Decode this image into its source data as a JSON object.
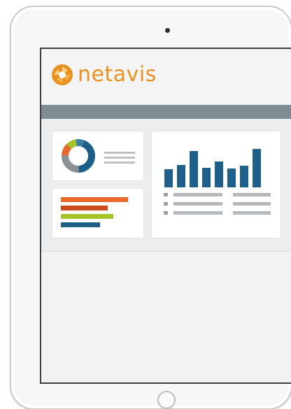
{
  "brand": {
    "name": "netavis",
    "color": "#e8921f"
  },
  "icons": {
    "logo": "netavis-shutter-logo",
    "camera": "front-camera-dot",
    "home": "home-button"
  },
  "colors": {
    "header_bar": "#7e8d94",
    "bar_blue": "#1f5f8b",
    "orange": "#e8682a",
    "dark_orange": "#c94b1b",
    "lime": "#a5c32b",
    "blue": "#1d5e89",
    "gray": "#8a9096"
  },
  "chart_data": [
    {
      "type": "pie",
      "labels": [],
      "values": [
        44,
        26,
        12,
        10,
        8
      ],
      "colors": [
        "#1d5e89",
        "#8a9096",
        "#e8682a",
        "#a5c32b",
        "#3a7fa8"
      ]
    },
    {
      "type": "bar",
      "orientation": "horizontal",
      "categories": [],
      "values": [
        1.0,
        0.7,
        0.78,
        0.58
      ],
      "colors": [
        "#e8682a",
        "#c94b1b",
        "#a5c32b",
        "#1d5e89"
      ]
    },
    {
      "type": "bar",
      "categories": [],
      "values": [
        0.5,
        0.62,
        1.0,
        0.54,
        0.72,
        0.52,
        0.6,
        1.06
      ],
      "colors": [
        "#1f5f8b"
      ]
    }
  ]
}
